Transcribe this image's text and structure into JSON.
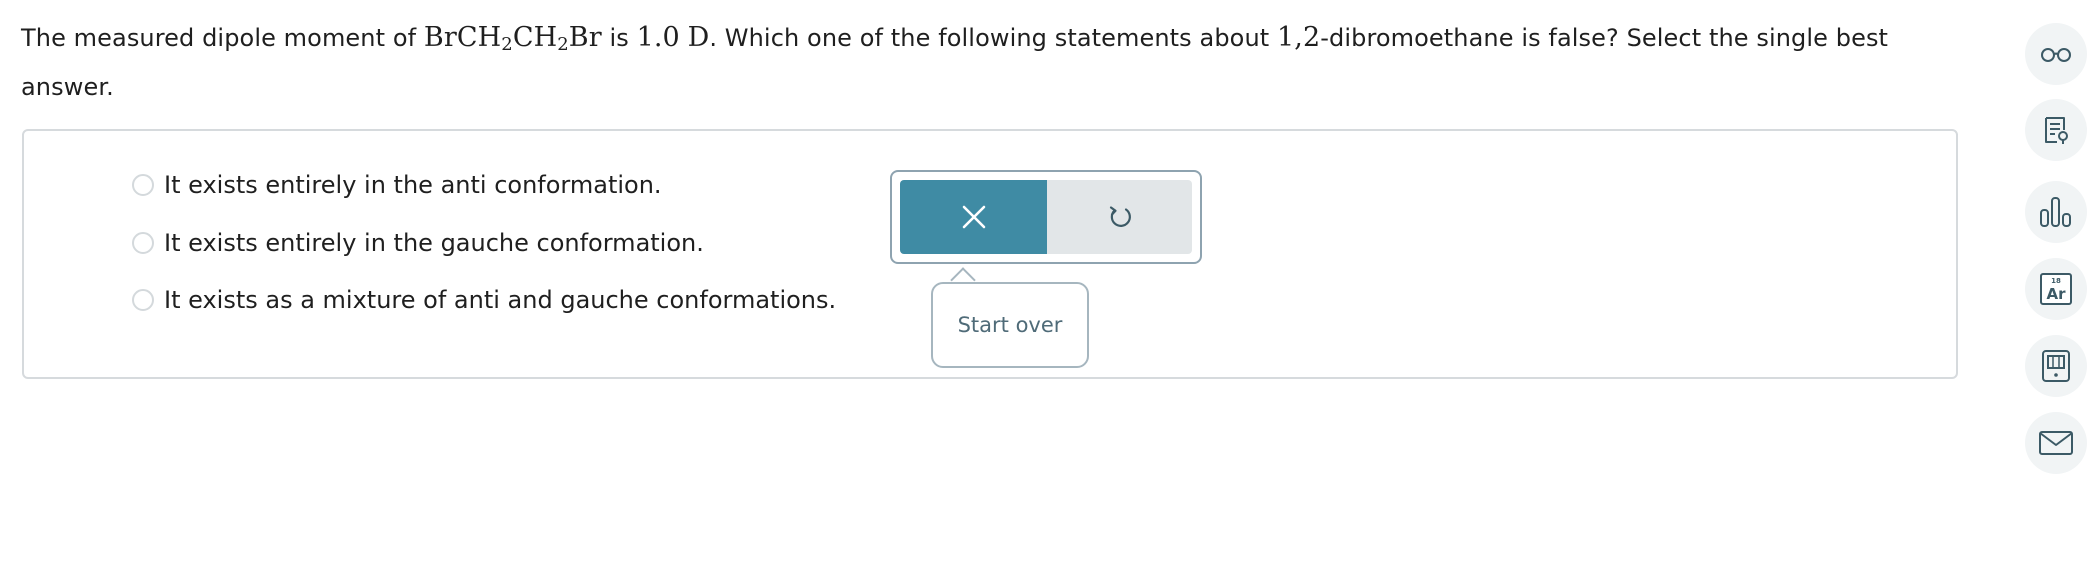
{
  "question": {
    "part1": "The measured dipole moment of ",
    "formula": {
      "a": "BrCH",
      "sub1": "2",
      "b": "CH",
      "sub2": "2",
      "c": "Br"
    },
    "part2": " is ",
    "value": "1.0",
    "unit": "D",
    "part3": ". Which one of the following statements about ",
    "compound_number": "1,2",
    "part4": "-dibromoethane is false? Select the single best answer."
  },
  "options": [
    {
      "label": "It exists entirely in the anti conformation."
    },
    {
      "label": "It exists entirely in the gauche conformation."
    },
    {
      "label": "It exists as a mixture of anti and gauche conformations."
    }
  ],
  "actions": {
    "clear_icon": "x-icon",
    "undo_icon": "undo-icon",
    "tooltip": "Start over"
  },
  "toolbar": {
    "items": [
      {
        "icon": "glasses-icon"
      },
      {
        "icon": "report-icon"
      },
      {
        "icon": "bar-chart-icon"
      },
      {
        "icon": "periodic-table-icon",
        "symbol": "Ar",
        "number": "18"
      },
      {
        "icon": "calculator-icon"
      },
      {
        "icon": "mail-icon"
      }
    ]
  },
  "colors": {
    "accent": "#3f8ba4",
    "icon": "#3c5a66"
  }
}
